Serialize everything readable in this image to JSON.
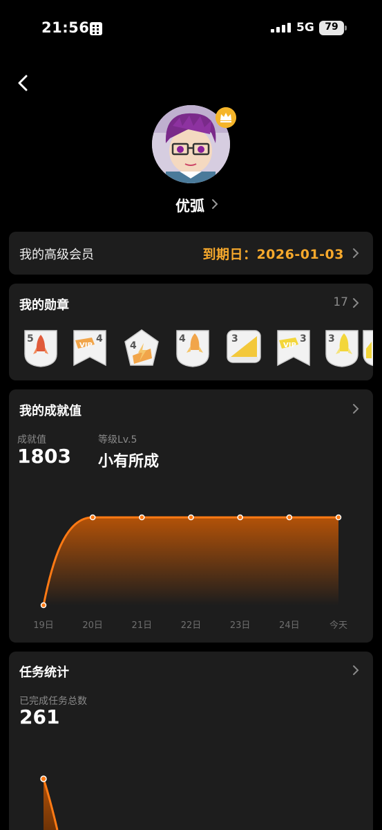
{
  "status_bar": {
    "time": "21:56",
    "network": "5G",
    "battery": "79"
  },
  "profile": {
    "username": "优弧"
  },
  "member": {
    "label": "我的高级会员",
    "expire_label": "到期日：2026-01-03"
  },
  "medals": {
    "title": "我的勋章",
    "count": "17",
    "items": [
      {
        "icon": "rocket-medal-icon",
        "level": "5"
      },
      {
        "icon": "vip-ribbon-medal-icon",
        "level": "4"
      },
      {
        "icon": "lightning-pentagon-medal-icon",
        "level": "4"
      },
      {
        "icon": "rocket-shield-medal-icon",
        "level": "4"
      },
      {
        "icon": "ruler-medal-icon",
        "level": "3"
      },
      {
        "icon": "vip-ribbon-medal-icon",
        "level": "3"
      },
      {
        "icon": "rocket-medal-icon",
        "level": "3"
      }
    ]
  },
  "achievement": {
    "title": "我的成就值",
    "value_label": "成就值",
    "value": "1803",
    "level_label": "等级Lv.5",
    "level_name": "小有所成"
  },
  "achievement_chart": {
    "type": "area",
    "categories": [
      "19日",
      "20日",
      "21日",
      "22日",
      "23日",
      "24日",
      "今天"
    ],
    "values": [
      0,
      1803,
      1803,
      1803,
      1803,
      1803,
      1803
    ],
    "ylim": [
      0,
      1803
    ],
    "color": "#ff7a14",
    "grid": false,
    "legend": "none"
  },
  "tasks": {
    "title": "任务统计",
    "total_label": "已完成任务总数",
    "total": "261"
  },
  "colors": {
    "accent_orange": "#f7a92c",
    "line_orange": "#ff7a14",
    "card_bg": "#1d1d1d"
  }
}
